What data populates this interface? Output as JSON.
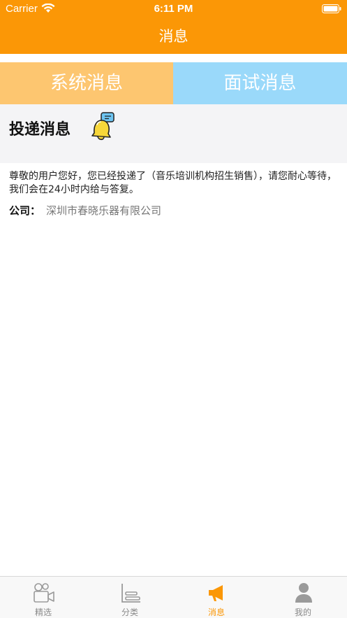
{
  "status_bar": {
    "carrier": "Carrier",
    "time": "6:11 PM"
  },
  "nav": {
    "title": "消息"
  },
  "tabs": [
    {
      "label": "系统消息"
    },
    {
      "label": "面试消息"
    }
  ],
  "section": {
    "title": "投递消息",
    "icon": "bell-icon"
  },
  "message": {
    "text": "尊敬的用户您好，您已经投递了（音乐培训机构招生销售），请您耐心等待，我们会在24小时内给与答复。",
    "company_label": "公司：",
    "company_name": "深圳市春晓乐器有限公司"
  },
  "tabbar": {
    "items": [
      {
        "label": "精选",
        "icon": "camera-icon"
      },
      {
        "label": "分类",
        "icon": "category-icon"
      },
      {
        "label": "消息",
        "icon": "megaphone-icon",
        "active": true
      },
      {
        "label": "我的",
        "icon": "user-icon"
      }
    ]
  },
  "colors": {
    "accent": "#fb9706",
    "tab_system": "#fdc670",
    "tab_interview": "#9ad9fa",
    "inactive": "#8a8a8a"
  }
}
